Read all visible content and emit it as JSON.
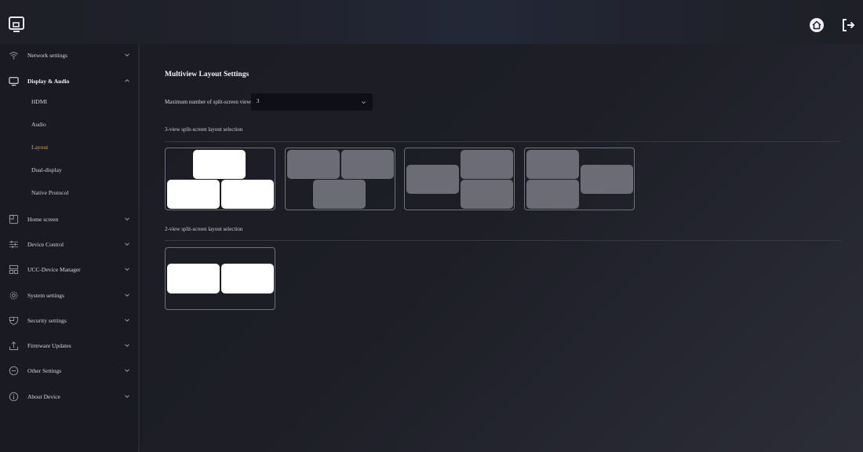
{
  "header": {
    "logo_icon": "monitor-logo-icon",
    "actions": [
      {
        "name": "home-button",
        "icon": "home-icon"
      },
      {
        "name": "logout-button",
        "icon": "logout-icon"
      }
    ]
  },
  "sidebar": {
    "items": [
      {
        "label": "Network settings",
        "icon": "wifi-icon",
        "expanded": false
      },
      {
        "label": "Display & Audio",
        "icon": "monitor-icon",
        "expanded": true,
        "children": [
          {
            "label": "HDMI"
          },
          {
            "label": "Audio"
          },
          {
            "label": "Layout",
            "active": true
          },
          {
            "label": "Dual-display"
          },
          {
            "label": "Native Protocol"
          }
        ]
      },
      {
        "label": "Home screen",
        "icon": "home-screen-icon",
        "expanded": false
      },
      {
        "label": "Device Control",
        "icon": "sliders-icon",
        "expanded": false
      },
      {
        "label": "UCC-Device Manager",
        "icon": "device-manager-icon",
        "expanded": false
      },
      {
        "label": "System settings",
        "icon": "gear-icon",
        "expanded": false
      },
      {
        "label": "Security settings",
        "icon": "shield-icon",
        "expanded": false
      },
      {
        "label": "Firmware Updates",
        "icon": "upload-icon",
        "expanded": false
      },
      {
        "label": "Other Settings",
        "icon": "more-icon",
        "expanded": false
      },
      {
        "label": "About Device",
        "icon": "info-icon",
        "expanded": false
      }
    ]
  },
  "main": {
    "title": "Multiview Layout Settings",
    "max_views_label": "Maximum number of split-screen views:",
    "max_views_value": "3",
    "three_view_label": "3-view split-screen layout selection",
    "two_view_label": "2-view split-screen layout selection",
    "three_view_layouts": [
      {
        "name": "one-top-two-bottom",
        "selected": true
      },
      {
        "name": "two-top-one-bottom",
        "selected": false
      },
      {
        "name": "one-left-two-right",
        "selected": false
      },
      {
        "name": "two-left-one-right",
        "selected": false
      }
    ],
    "two_view_layouts": [
      {
        "name": "side-by-side",
        "selected": true
      }
    ]
  },
  "colors": {
    "active_nav": "#d8a23a",
    "selected_window": "#ffffff",
    "unselected_window": "#6b6c76"
  }
}
